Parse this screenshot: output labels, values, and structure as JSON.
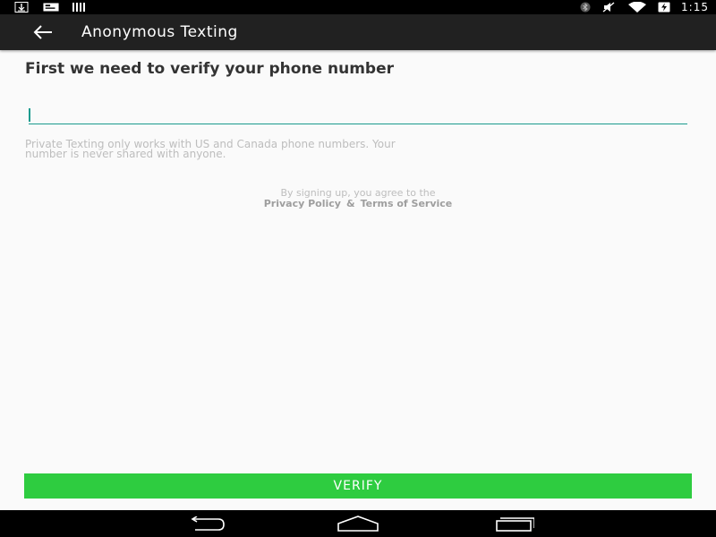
{
  "status_bar": {
    "time": "1:15",
    "left_icons": [
      "download-icon",
      "message-icon",
      "barcode-icon"
    ],
    "right_icons": [
      "bluetooth-icon",
      "mute-icon",
      "wifi-icon",
      "battery-icon"
    ]
  },
  "app_bar": {
    "title": "Anonymous Texting",
    "back_icon": "arrow-left-icon"
  },
  "form": {
    "heading": "First we need to verify your phone number",
    "phone_value": "",
    "phone_placeholder": "",
    "disclaimer": "Private Texting only works with US and Canada phone numbers. Your number is never shared with anyone.",
    "agree_text": "By signing up, you agree to the",
    "privacy_link": "Privacy Policy",
    "ampersand": "&",
    "terms_link": "Terms of Service"
  },
  "verify_button": {
    "label": "VERIFY",
    "color": "#2ecc40"
  },
  "nav_bar": {
    "buttons": [
      "back-icon",
      "home-icon",
      "recents-icon"
    ]
  },
  "colors": {
    "app_bar": "#212121",
    "accent": "#1a9b8e",
    "background": "#fafafa"
  }
}
